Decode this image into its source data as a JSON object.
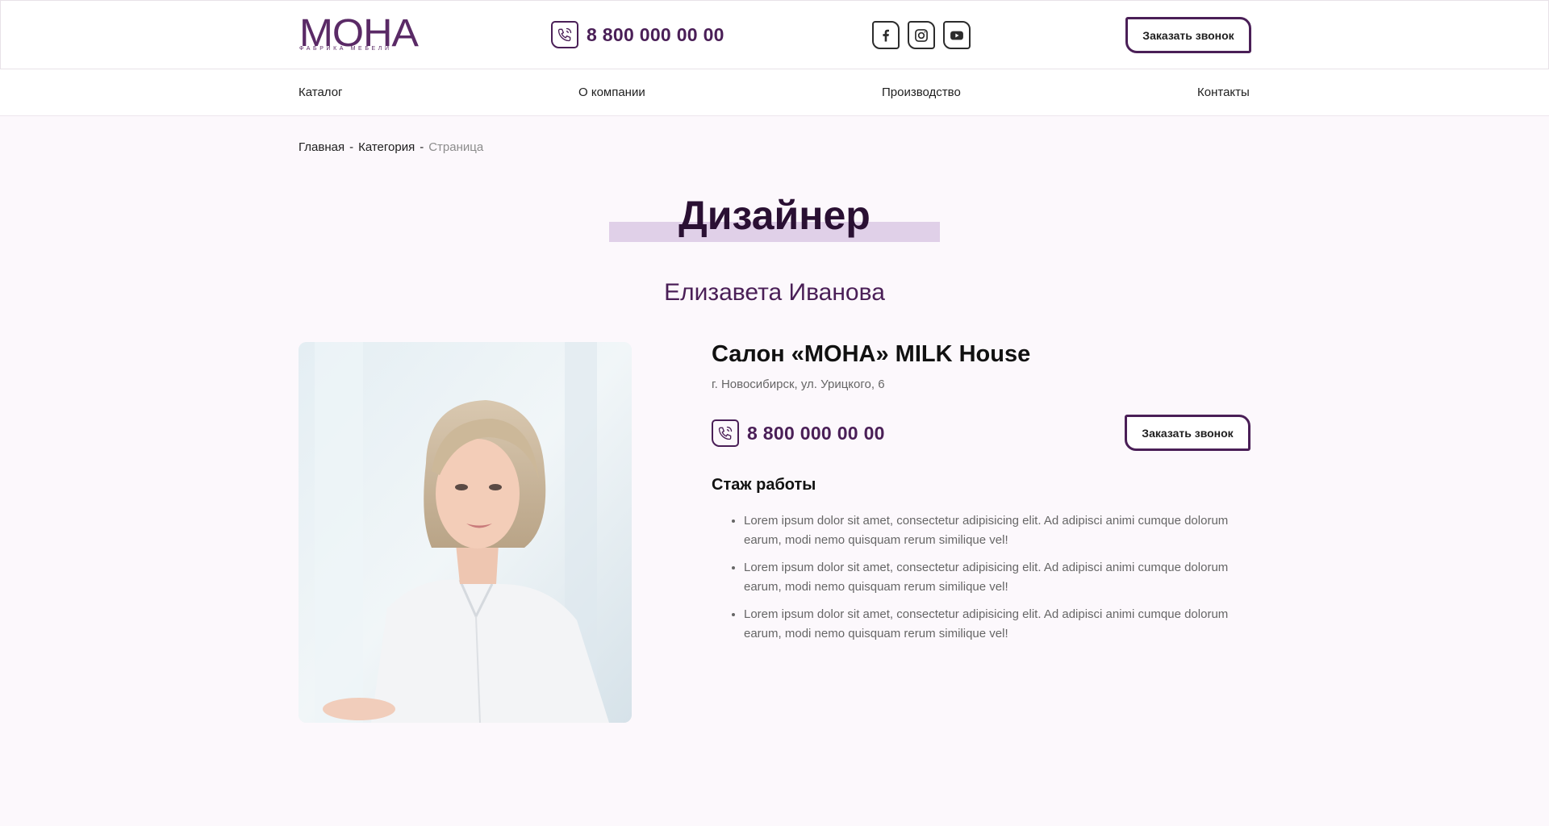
{
  "header": {
    "logo_text": "МОНА",
    "logo_sub": "ФАБРИКА МЕБЕЛИ",
    "phone": "8 800 000 00 00",
    "socials": [
      {
        "name": "facebook-icon"
      },
      {
        "name": "instagram-icon"
      },
      {
        "name": "youtube-icon"
      }
    ],
    "call_button": "Заказать звонок"
  },
  "nav": {
    "items": [
      {
        "label": "Каталог"
      },
      {
        "label": "О компании"
      },
      {
        "label": "Производство"
      },
      {
        "label": "Контакты"
      }
    ]
  },
  "breadcrumb": {
    "home": "Главная",
    "category": "Категория",
    "current": "Страница",
    "separator": "-"
  },
  "page": {
    "title": "Дизайнер",
    "person_name": "Елизавета Иванова"
  },
  "salon": {
    "title": "Салон «МОНА» MILK House",
    "address": "г. Новосибирск, ул. Урицкого, 6",
    "phone": "8 800 000 00 00",
    "call_button": "Заказать звонок"
  },
  "experience": {
    "title": "Стаж работы",
    "items": [
      "Lorem ipsum dolor sit amet, consectetur adipisicing elit. Ad adipisci animi cumque dolorum earum, modi nemo quisquam rerum similique vel!",
      "Lorem ipsum dolor sit amet, consectetur adipisicing elit. Ad adipisci animi cumque dolorum earum, modi nemo quisquam rerum similique vel!",
      "Lorem ipsum dolor sit amet, consectetur adipisicing elit. Ad adipisci animi cumque dolorum earum, modi nemo quisquam rerum similique vel!"
    ]
  },
  "colors": {
    "brand": "#4a1f57",
    "background": "#fcf8fc",
    "title_highlight": "#e0d0e8"
  }
}
